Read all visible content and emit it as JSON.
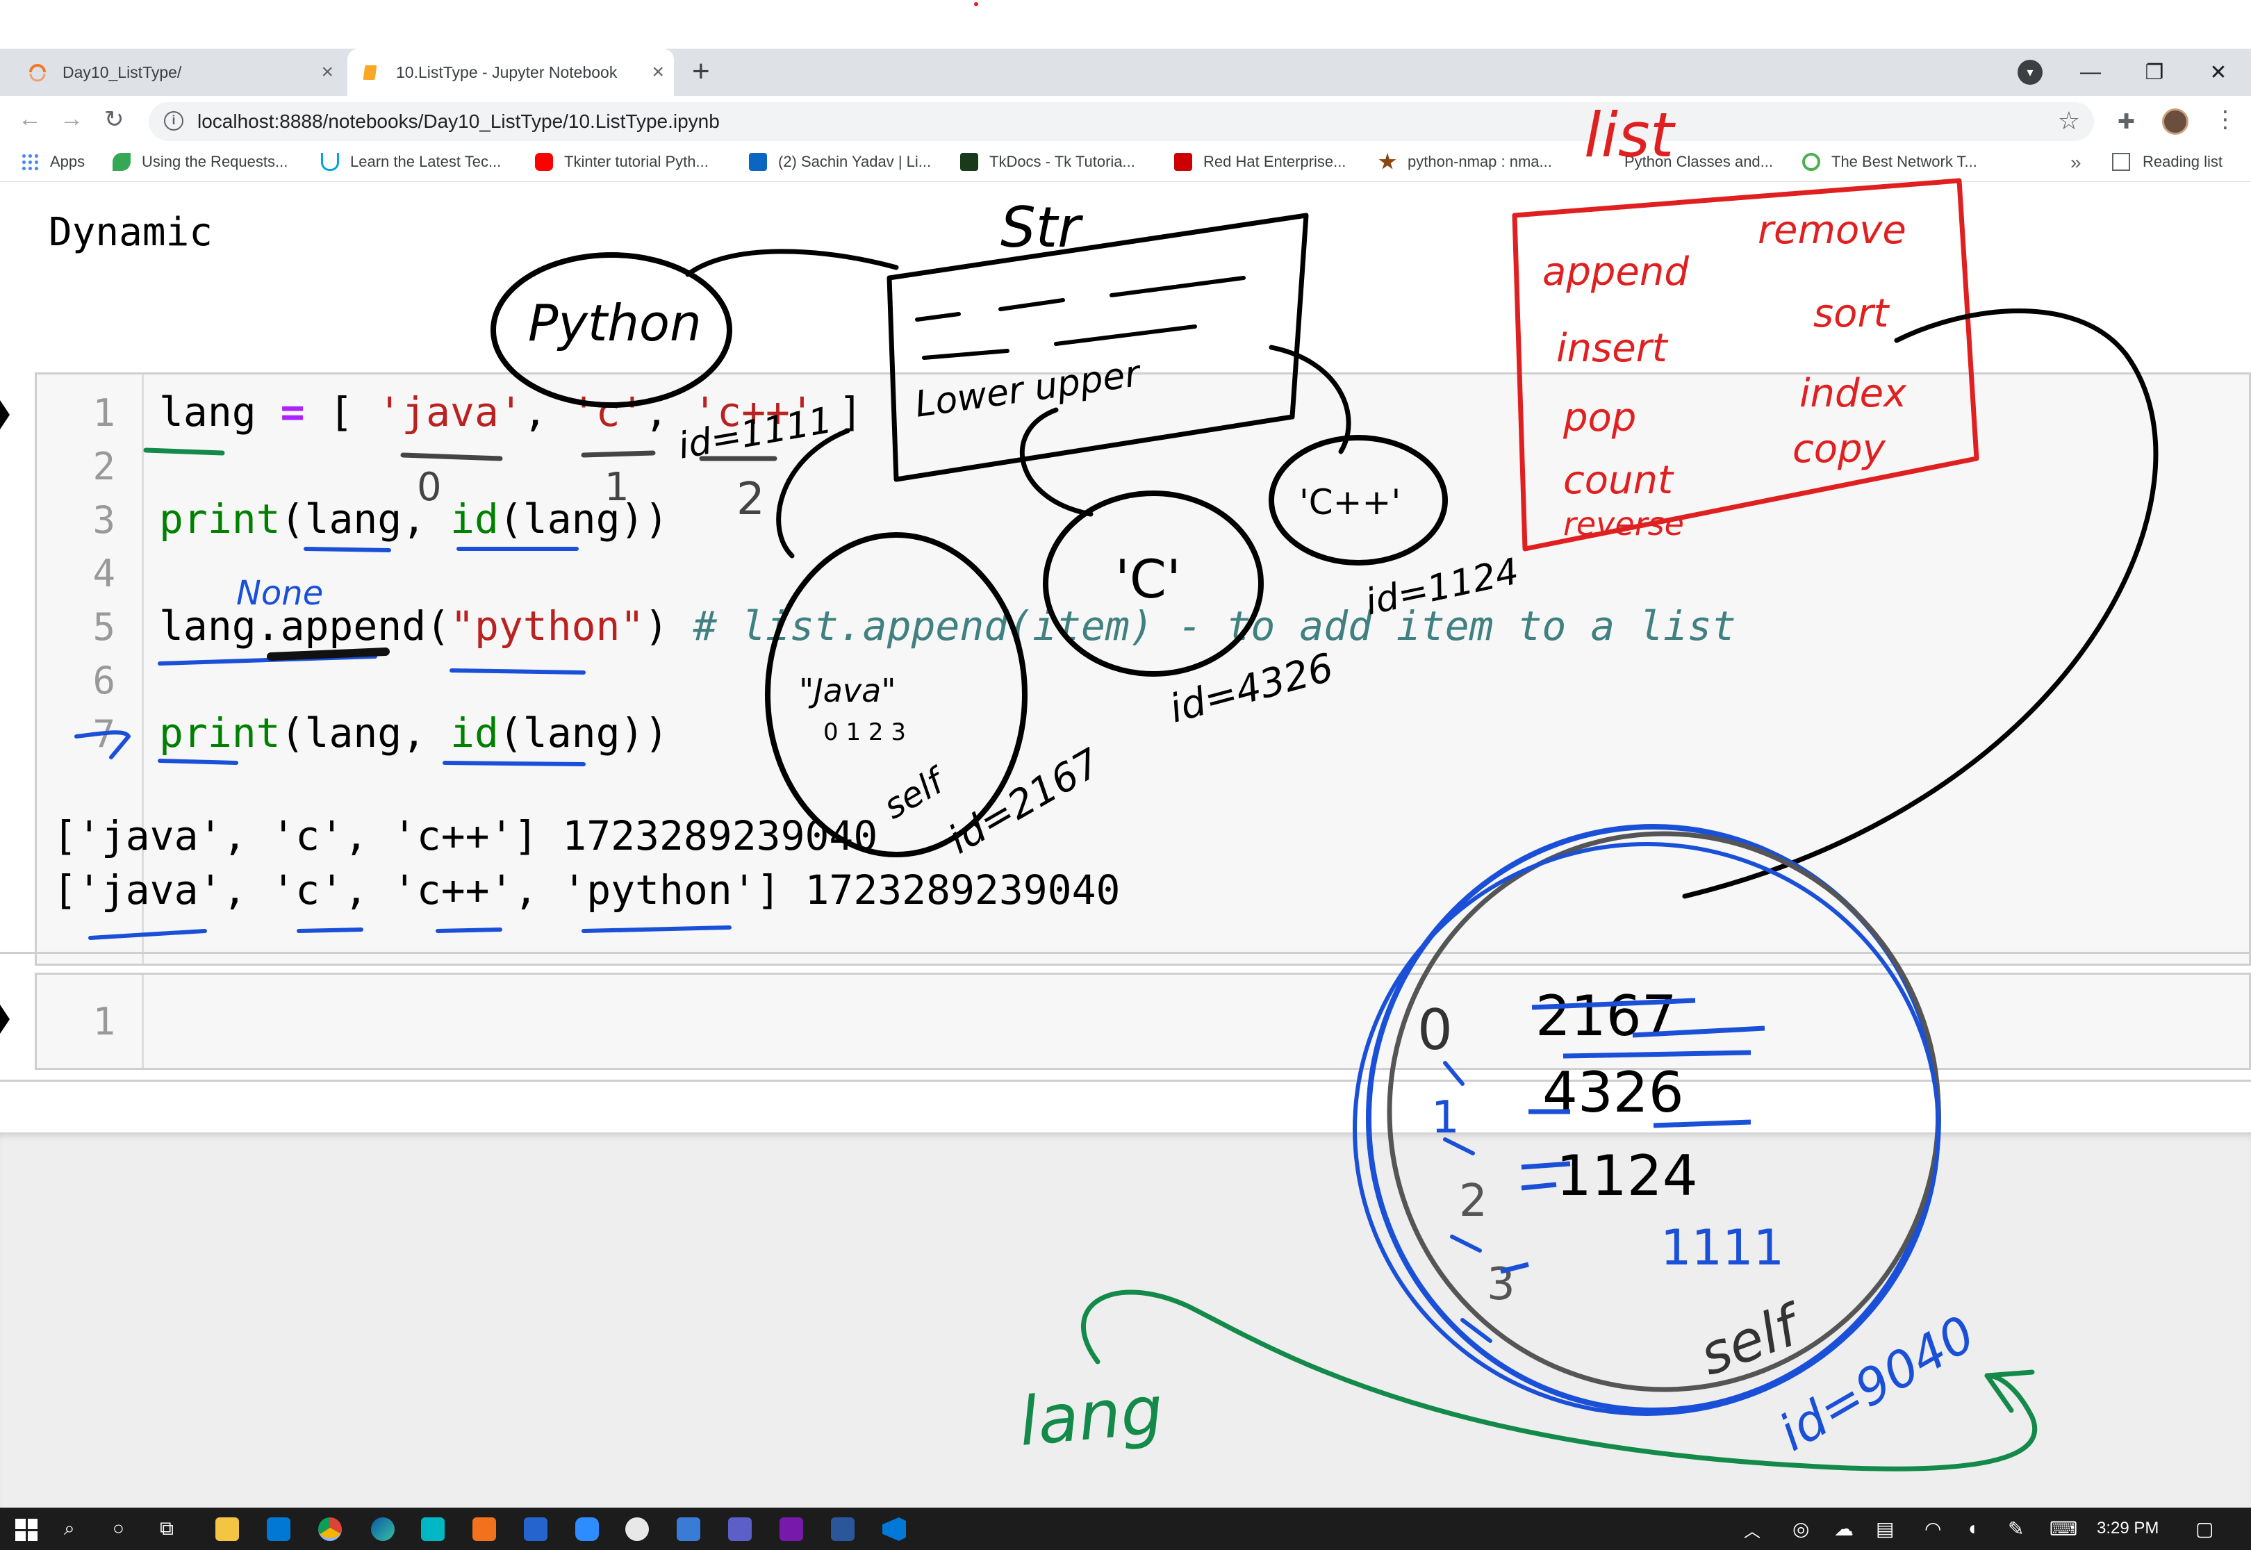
{
  "browser": {
    "tabs": [
      {
        "title": "Day10_ListType/"
      },
      {
        "title": "10.ListType - Jupyter Notebook"
      }
    ],
    "url": "localhost:8888/notebooks/Day10_ListType/10.ListType.ipynb",
    "bookmarks": [
      {
        "label": "Apps",
        "color": "#4285f4"
      },
      {
        "label": "Using the Requests...",
        "color": "#34a853"
      },
      {
        "label": "Learn the Latest Tec...",
        "color": "#00a3e0"
      },
      {
        "label": "Tkinter tutorial Pyth...",
        "color": "#ff0000"
      },
      {
        "label": "(2) Sachin Yadav | Li...",
        "color": "#0a66c2"
      },
      {
        "label": "TkDocs - Tk Tutoria...",
        "color": "#1b3a1b"
      },
      {
        "label": "Red Hat Enterprise...",
        "color": "#cc0000"
      },
      {
        "label": "python-nmap : nma...",
        "color": "#8b4513"
      },
      {
        "label": "Python Classes and...",
        "color": "#ffffff"
      },
      {
        "label": "The Best Network T...",
        "color": "#4caf50"
      }
    ],
    "more_label": "»",
    "reading_list": "Reading list"
  },
  "notebook": {
    "markdown_text": "Dynamic",
    "cell1": {
      "line_numbers": [
        "1",
        "2",
        "3",
        "4",
        "5",
        "6",
        "7"
      ],
      "output_lines": [
        "['java', 'c', 'c++'] 1723289239040",
        "['java', 'c', 'c++', 'python'] 1723289239040"
      ]
    },
    "cell2": {
      "line_numbers": [
        "1"
      ]
    }
  },
  "annotations": {
    "python_bubble": "Python",
    "str_label": "Str",
    "str_box": "Lower upper",
    "list_label": "list",
    "methods": [
      "append",
      "remove",
      "insert",
      "sort",
      "pop",
      "index",
      "count",
      "copy",
      "reverse"
    ],
    "index_zero": "0",
    "index_one": "1",
    "index_two": "2",
    "id_1111": "id=1111",
    "java_bubble": "\"Java\"",
    "java_idx": "0 1 2 3",
    "self_java": "self",
    "id_2167": "id=2167",
    "c_bubble": "'C'",
    "id_4326": "id=4326",
    "cpp_bubble": "'C++'",
    "id_1124": "id=1124",
    "none_note": "None",
    "list_rows": [
      {
        "idx": "0",
        "val": "2167"
      },
      {
        "idx": "1",
        "val": "4326"
      },
      {
        "idx": "2",
        "val": "1124"
      },
      {
        "idx": "3",
        "val": "1111"
      }
    ],
    "self_list": "self",
    "id_9040": "id=9040",
    "lang_label": "lang"
  },
  "taskbar": {
    "time": "3:29 PM"
  }
}
